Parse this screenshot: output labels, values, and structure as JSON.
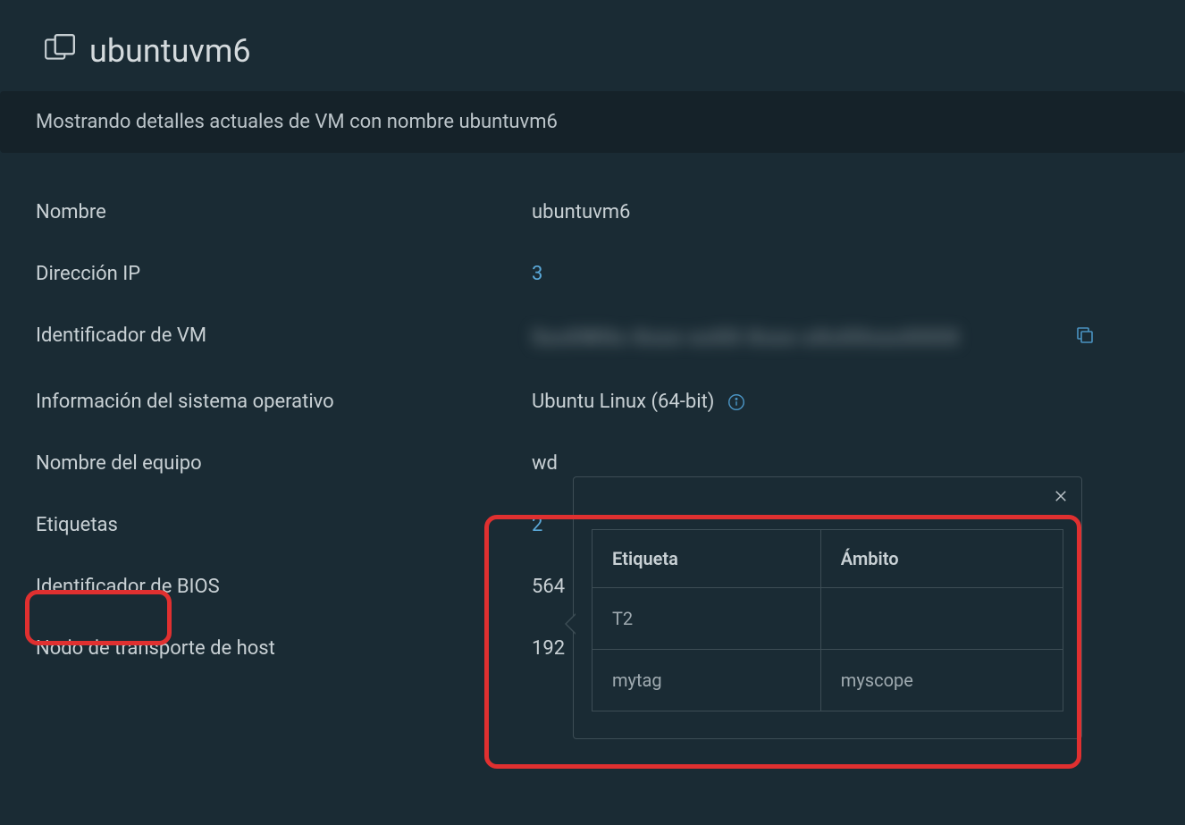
{
  "header": {
    "title": "ubuntuvm6"
  },
  "subtitle": "Mostrando detalles actuales de VM con nombre ubuntuvm6",
  "details": {
    "name_label": "Nombre",
    "name_value": "ubuntuvm6",
    "ip_label": "Dirección IP",
    "ip_value": "3",
    "vmid_label": "Identificador de VM",
    "vmid_value": "5xxXWXx-Xxxx-xxXX-Xxxx-xXxXXxxxXXXX",
    "os_label": "Información del sistema operativo",
    "os_value": "Ubuntu Linux (64-bit)",
    "hostname_label": "Nombre del equipo",
    "hostname_value": "wd",
    "tags_label": "Etiquetas",
    "tags_value": "2",
    "bios_label": "Identificador de BIOS",
    "bios_value": "564",
    "transport_label": "Nodo de transporte de host",
    "transport_value": "192"
  },
  "popover": {
    "headers": {
      "tag": "Etiqueta",
      "scope": "Ámbito"
    },
    "rows": [
      {
        "tag": "T2",
        "scope": ""
      },
      {
        "tag": "mytag",
        "scope": "myscope"
      }
    ]
  }
}
